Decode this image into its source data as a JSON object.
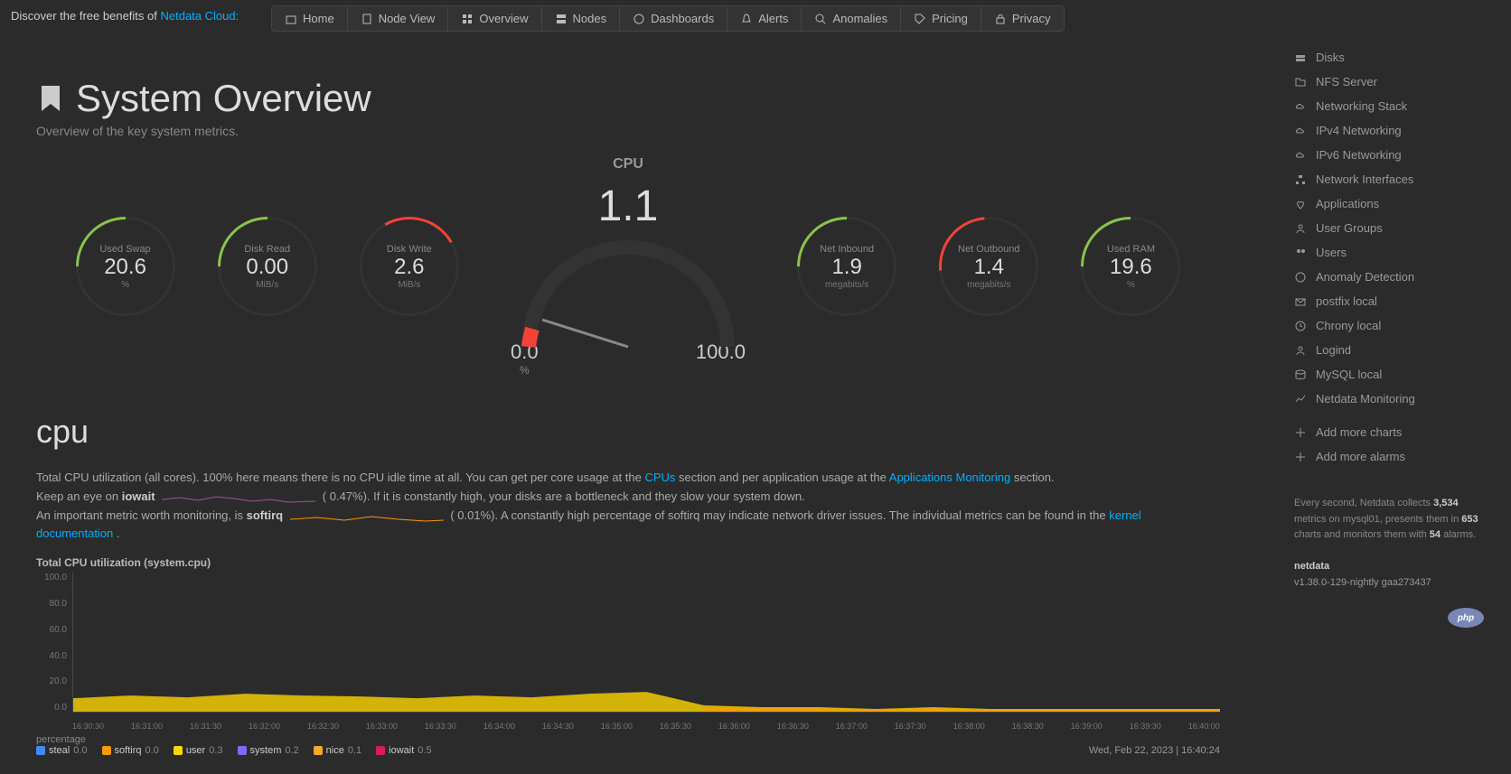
{
  "banner": {
    "text_prefix": "Discover the free benefits of ",
    "link": "Netdata Cloud:"
  },
  "nav": {
    "items": [
      {
        "label": "Home",
        "icon": "home"
      },
      {
        "label": "Node View",
        "icon": "node"
      },
      {
        "label": "Overview",
        "icon": "overview"
      },
      {
        "label": "Nodes",
        "icon": "nodes"
      },
      {
        "label": "Dashboards",
        "icon": "dashboards"
      },
      {
        "label": "Alerts",
        "icon": "alerts"
      },
      {
        "label": "Anomalies",
        "icon": "anomalies"
      },
      {
        "label": "Pricing",
        "icon": "pricing"
      },
      {
        "label": "Privacy",
        "icon": "privacy"
      }
    ]
  },
  "page": {
    "title": "System Overview",
    "subtitle": "Overview of the key system metrics."
  },
  "gauges": {
    "used_swap": {
      "label": "Used Swap",
      "value": "20.6",
      "unit": "%"
    },
    "disk_read": {
      "label": "Disk Read",
      "value": "0.00",
      "unit": "MiB/s"
    },
    "disk_write": {
      "label": "Disk Write",
      "value": "2.6",
      "unit": "MiB/s"
    },
    "cpu": {
      "label": "CPU",
      "value": "1.1",
      "min": "0.0",
      "max": "100.0",
      "unit": "%"
    },
    "net_in": {
      "label": "Net Inbound",
      "value": "1.9",
      "unit": "megabits/s"
    },
    "net_out": {
      "label": "Net Outbound",
      "value": "1.4",
      "unit": "megabits/s"
    },
    "used_ram": {
      "label": "Used RAM",
      "value": "19.6",
      "unit": "%"
    }
  },
  "cpu_section": {
    "title": "cpu",
    "desc_line1_a": "Total CPU utilization (all cores). 100% here means there is no CPU idle time at all. You can get per core usage at the ",
    "desc_line1_link1": "CPUs",
    "desc_line1_b": " section and per application usage at the ",
    "desc_line1_link2": "Applications Monitoring",
    "desc_line1_c": " section.",
    "desc_line2_a": "Keep an eye on ",
    "desc_line2_strong": "iowait",
    "desc_line2_b": "0.47%). If it is constantly high, your disks are a bottleneck and they slow your system down.",
    "desc_line3_a": "An important metric worth monitoring, is ",
    "desc_line3_strong": "softirq",
    "desc_line3_b": "0.01%). A constantly high percentage of softirq may indicate network driver issues. The individual metrics can be found in the ",
    "desc_line3_link": "kernel documentation",
    "desc_line3_c": "."
  },
  "chart_title": "Total CPU utilization (system.cpu)",
  "chart_data": {
    "type": "area",
    "title": "Total CPU utilization (system.cpu)",
    "xlabel": "",
    "ylabel": "percentage",
    "ylim": [
      0,
      100
    ],
    "yticks": [
      "100.0",
      "80.0",
      "60.0",
      "40.0",
      "20.0",
      "0.0"
    ],
    "xticks": [
      "16:30:30",
      "16:31:00",
      "16:31:30",
      "16:32:00",
      "16:32:30",
      "16:33:00",
      "16:33:30",
      "16:34:00",
      "16:34:30",
      "16:35:00",
      "16:35:30",
      "16:36:00",
      "16:36:30",
      "16:37:00",
      "16:37:30",
      "16:38:00",
      "16:38:30",
      "16:39:00",
      "16:39:30",
      "16:40:00"
    ],
    "series": [
      {
        "name": "steal",
        "value": "0.0",
        "color": "#3f8cff"
      },
      {
        "name": "softirq",
        "value": "0.0",
        "color": "#ff9800"
      },
      {
        "name": "user",
        "value": "0.3",
        "color": "#ffd600"
      },
      {
        "name": "system",
        "value": "0.2",
        "color": "#7c6bff"
      },
      {
        "name": "nice",
        "value": "0.1",
        "color": "#ffa726"
      },
      {
        "name": "iowait",
        "value": "0.5",
        "color": "#d81b60"
      }
    ],
    "stacked_approx": {
      "comment": "approximate total stacked height over time, read from screenshot",
      "x_index": [
        0,
        1,
        2,
        3,
        4,
        5,
        6,
        7,
        8,
        9,
        10,
        11,
        12,
        13,
        14,
        15,
        16,
        17,
        18,
        19
      ],
      "total_pct": [
        10,
        12,
        11,
        13,
        12,
        11,
        10,
        12,
        11,
        13,
        14,
        13,
        12,
        4,
        3,
        3,
        2,
        3,
        2,
        2
      ]
    }
  },
  "chart_footer": {
    "ylabel": "percentage",
    "timestamp": "Wed, Feb 22, 2023 | 16:40:24"
  },
  "sidebar": {
    "items": [
      {
        "label": "Disks",
        "icon": "disks"
      },
      {
        "label": "NFS Server",
        "icon": "folder"
      },
      {
        "label": "Networking Stack",
        "icon": "cloud"
      },
      {
        "label": "IPv4 Networking",
        "icon": "cloud"
      },
      {
        "label": "IPv6 Networking",
        "icon": "cloud"
      },
      {
        "label": "Network Interfaces",
        "icon": "sitemap"
      },
      {
        "label": "Applications",
        "icon": "heart"
      },
      {
        "label": "User Groups",
        "icon": "user"
      },
      {
        "label": "Users",
        "icon": "users"
      },
      {
        "label": "Anomaly Detection",
        "icon": "brain"
      },
      {
        "label": "postfix local",
        "icon": "mail"
      },
      {
        "label": "Chrony local",
        "icon": "clock"
      },
      {
        "label": "Logind",
        "icon": "user"
      },
      {
        "label": "MySQL local",
        "icon": "db"
      },
      {
        "label": "Netdata Monitoring",
        "icon": "chart"
      }
    ],
    "add_charts": "Add more charts",
    "add_alarms": "Add more alarms",
    "info_1a": "Every second, Netdata collects ",
    "info_1b": "3,534",
    "info_1c": " metrics on mysql01, presents them in ",
    "info_1d": "653",
    "info_1e": " charts and monitors them with ",
    "info_1f": "54",
    "info_1g": " alarms.",
    "product": "netdata",
    "version": "v1.38.0-129-nightly gaa273437"
  },
  "php_logo": "php"
}
